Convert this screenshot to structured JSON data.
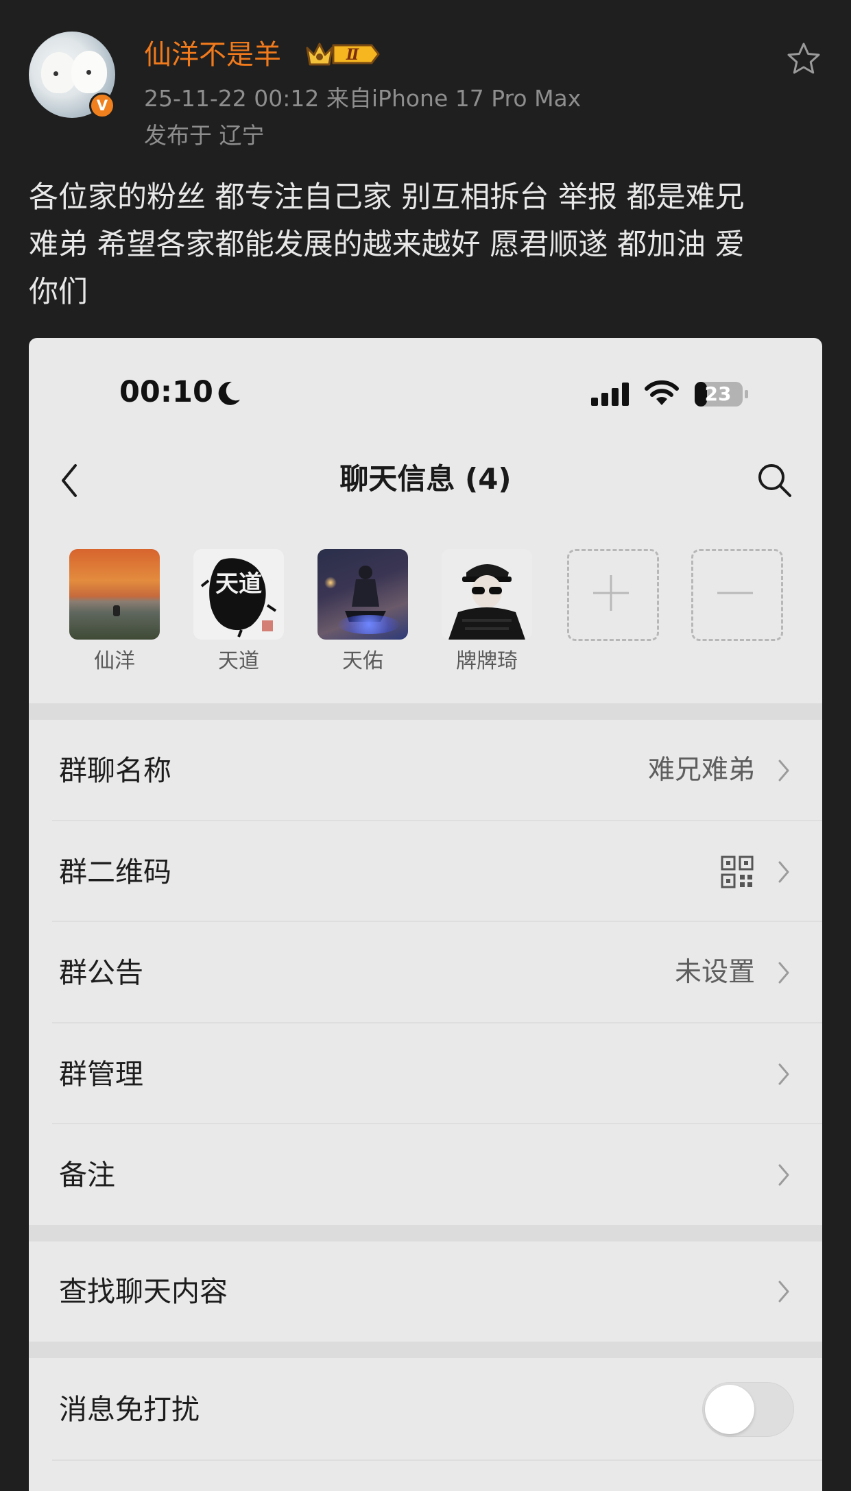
{
  "post": {
    "author": "仙洋不是羊",
    "verified_badge": "V",
    "vip_level": "Ⅱ",
    "meta": "25-11-22 00:12  来自iPhone 17 Pro Max",
    "location": "发布于 辽宁",
    "body": "各位家的粉丝 都专注自己家 别互相拆台 举报 都是难兄\n难弟 希望各家都能发展的越来越好 愿君顺遂 都加油 爱\n你们",
    "favorite_icon": "star-outline-icon",
    "accent_color": "#f17a1c"
  },
  "screenshot": {
    "status_bar": {
      "time": "00:10",
      "focus_icon": "moon-icon",
      "battery": "23"
    },
    "nav": {
      "title": "聊天信息 (4)",
      "back_icon": "chevron-left-icon",
      "search_icon": "search-icon"
    },
    "members": [
      {
        "name": "仙洋",
        "avatar": "sunset-sea-avatar"
      },
      {
        "name": "天道",
        "avatar": "calligraphy-avatar",
        "avatar_text": "天道"
      },
      {
        "name": "天佑",
        "avatar": "night-motorbike-avatar"
      },
      {
        "name": "牌牌琦",
        "avatar": "sunglasses-avatar"
      }
    ],
    "add_member_icon": "plus-icon",
    "remove_member_icon": "minus-icon",
    "settings": [
      {
        "label": "群聊名称",
        "value": "难兄难弟"
      },
      {
        "label": "群二维码",
        "value_icon": "qr-code-icon"
      },
      {
        "label": "群公告",
        "value": "未设置"
      },
      {
        "label": "群管理"
      },
      {
        "label": "备注"
      }
    ],
    "search_history": {
      "label": "查找聊天内容"
    },
    "mute": {
      "label": "消息免打扰",
      "enabled": false
    }
  }
}
